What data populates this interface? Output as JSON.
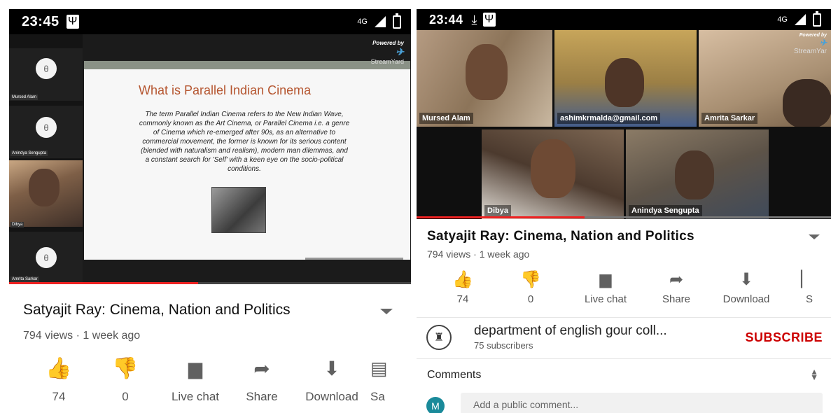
{
  "left": {
    "status": {
      "time": "23:45",
      "network": "4G"
    },
    "stream": {
      "participants": [
        {
          "name": "Mursed Alam",
          "initial": "θ"
        },
        {
          "name": "Anindya Sengupta",
          "initial": "θ"
        },
        {
          "name": "Dibya"
        },
        {
          "name": "Amrita Sarkar",
          "initial": "θ"
        }
      ],
      "slide_title": "What is Parallel Indian Cinema",
      "slide_body": "The term Parallel Indian Cinema refers to the New Indian Wave, commonly known as the Art Cinema, or Parallel Cinema i.e. a genre of Cinema which re-emerged after 90s, as an alternative to commercial movement, the former is known for its serious content (blended with naturalism and realism), modern man dilemmas, and a constant search for 'Self' with a keen eye on the socio-political conditions.",
      "powered_by": "Powered by",
      "brand": "StreamYard"
    },
    "video": {
      "title": "Satyajit Ray: Cinema, Nation and Politics",
      "meta": "794 views · 1 week ago"
    },
    "actions": [
      {
        "icon": "thumbs-up-icon",
        "label": "74"
      },
      {
        "icon": "thumbs-down-icon",
        "label": "0"
      },
      {
        "icon": "live-chat-icon",
        "label": "Live chat"
      },
      {
        "icon": "share-icon",
        "label": "Share"
      },
      {
        "icon": "download-icon",
        "label": "Download"
      },
      {
        "icon": "save-icon",
        "label": "Sa"
      }
    ]
  },
  "right": {
    "status": {
      "time": "23:44",
      "network": "4G"
    },
    "stream": {
      "participants": [
        {
          "name": "Mursed Alam"
        },
        {
          "name": "ashimkrmalda@gmail.com"
        },
        {
          "name": "Amrita Sarkar"
        },
        {
          "name": "Dibya"
        },
        {
          "name": "Anindya Sengupta"
        }
      ],
      "powered_by": "Powered by",
      "brand": "StreamYar"
    },
    "video": {
      "title": "Satyajit Ray: Cinema, Nation and Politics",
      "meta": "794 views · 1 week ago"
    },
    "actions": [
      {
        "icon": "thumbs-up-icon",
        "label": "74"
      },
      {
        "icon": "thumbs-down-icon",
        "label": "0"
      },
      {
        "icon": "live-chat-icon",
        "label": "Live chat"
      },
      {
        "icon": "share-icon",
        "label": "Share"
      },
      {
        "icon": "download-icon",
        "label": "Download"
      },
      {
        "icon": "save-icon",
        "label": "S"
      }
    ],
    "channel": {
      "name": "department of english gour coll...",
      "subscribers": "75 subscribers",
      "subscribe_label": "SUBSCRIBE"
    },
    "comments": {
      "title": "Comments",
      "avatar_letter": "M",
      "placeholder": "Add a public comment..."
    }
  },
  "colors": {
    "like_blue": "#1a73e8",
    "icon_grey": "#606060",
    "subscribe_red": "#cc0000",
    "progress_red": "#e52222"
  }
}
